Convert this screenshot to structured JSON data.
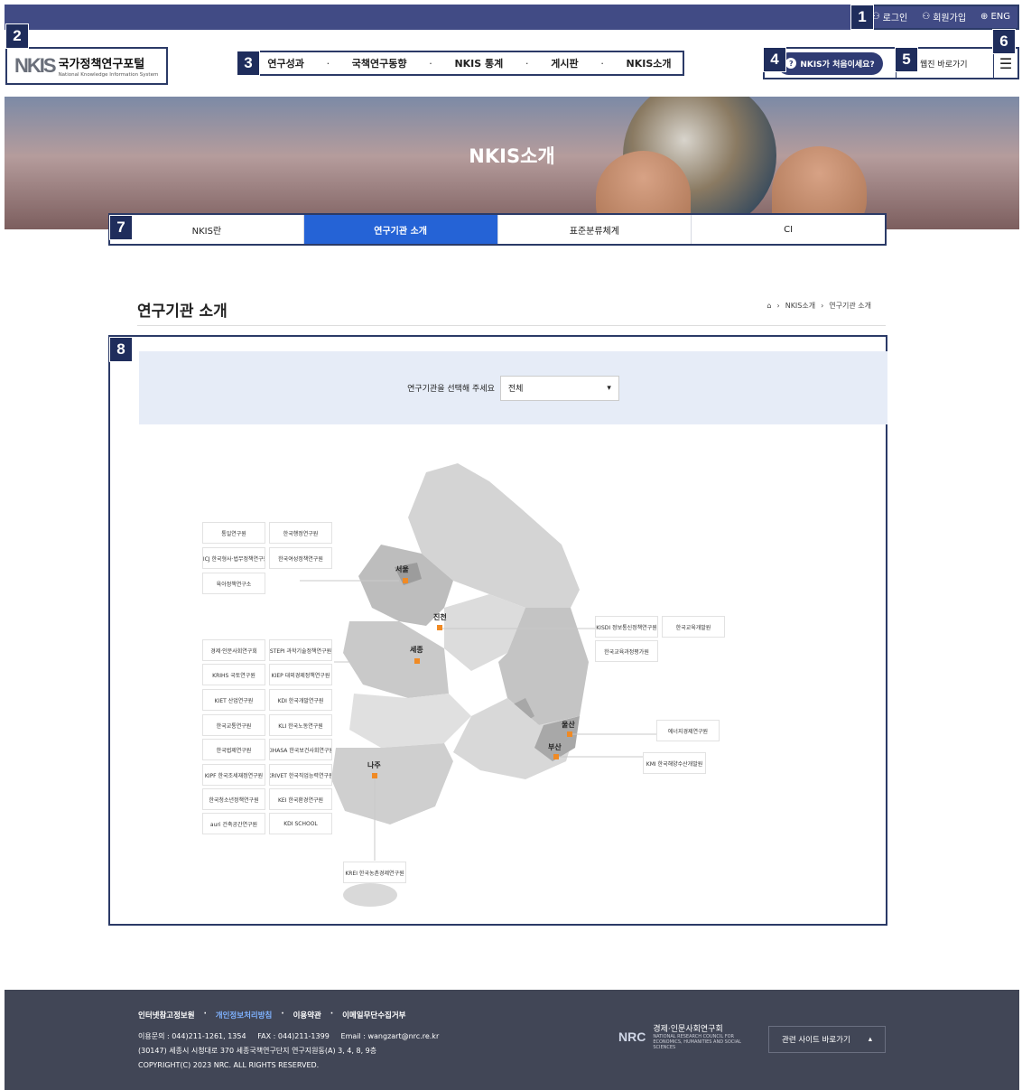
{
  "topbar": {
    "login": "로그인",
    "signup": "회원가입",
    "lang": "ENG"
  },
  "logo": {
    "mark": "NKIS",
    "title": "국가정책연구포털",
    "subtitle": "National Knowledge Information System"
  },
  "nav": [
    "연구성과",
    "국책연구동향",
    "NKIS 통계",
    "게시판",
    "NKIS소개"
  ],
  "header": {
    "first_visit": "NKIS가 처음이세요?",
    "quick_link": "웹진 바로가기"
  },
  "hero": {
    "title": "NKIS소개"
  },
  "tabs": [
    {
      "label": "NKIS란",
      "active": false
    },
    {
      "label": "연구기관 소개",
      "active": true
    },
    {
      "label": "표준분류체계",
      "active": false
    },
    {
      "label": "CI",
      "active": false
    }
  ],
  "page": {
    "title": "연구기관 소개",
    "breadcrumb": [
      "NKIS소개",
      "연구기관 소개"
    ]
  },
  "filter": {
    "label": "연구기관을 선택해 주세요",
    "value": "전체"
  },
  "map": {
    "cities": [
      "서울",
      "진천",
      "세종",
      "울산",
      "부산",
      "나주"
    ],
    "seoul_orgs": [
      "통일연구원",
      "한국행정연구원",
      "KICJ 한국형사·법무정책연구원",
      "한국여성정책연구원",
      "육아정책연구소"
    ],
    "sejong_orgs": [
      "경제·인문사회연구회",
      "STEPI 과학기술정책연구원",
      "KRIHS 국토연구원",
      "KIEP 대외경제정책연구원",
      "KIET 산업연구원",
      "KDI 한국개발연구원",
      "한국교통연구원",
      "KLI 한국노동연구원",
      "한국법제연구원",
      "KIHASA 한국보건사회연구원",
      "KIPF 한국조세재정연구원",
      "KRIVET 한국직업능력연구원",
      "한국청소년정책연구원",
      "KEI 한국환경연구원",
      "auri 건축공간연구원",
      "KDI SCHOOL"
    ],
    "jincheon_orgs": [
      "KISDI 정보통신정책연구원",
      "한국교육개발원",
      "한국교육과정평가원"
    ],
    "ulsan_orgs": [
      "에너지경제연구원"
    ],
    "busan_orgs": [
      "KMI 한국해양수산개발원"
    ],
    "naju_orgs": [
      "KREI 한국농촌경제연구원"
    ]
  },
  "footer": {
    "links": [
      "인터넷참고정보원",
      "개인정보처리방침",
      "이용약관",
      "이메일무단수집거부"
    ],
    "contact": "이용문의 : 044)211-1261, 1354     FAX : 044)211-1399     Email : wangzart@nrc.re.kr",
    "address": "(30147) 세종시 시청대로 370 세종국책연구단지 연구지원동(A) 3, 4, 8, 9층",
    "copyright": "COPYRIGHT(C) 2023 NRC. ALL RIGHTS RESERVED.",
    "nrc_name": "경제·인문사회연구회",
    "nrc_en": "NATIONAL RESEARCH COUNCIL FOR ECONOMICS, HUMANITIES AND SOCIAL SCIENCES",
    "related": "관련 사이트 바로가기"
  },
  "colors": {
    "accent": "#2563d6",
    "topbar": "#414b85",
    "pin": "#f08a24",
    "footer": "#414656"
  }
}
